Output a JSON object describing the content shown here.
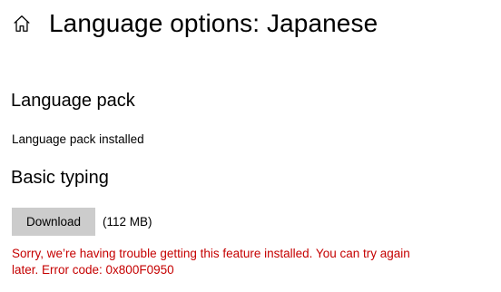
{
  "header": {
    "home_icon": "home-icon",
    "title": "Language options: Japanese"
  },
  "language_pack": {
    "heading": "Language pack",
    "status": "Language pack installed"
  },
  "basic_typing": {
    "heading": "Basic typing",
    "download_label": "Download",
    "size": "(112 MB)",
    "error": "Sorry, we’re having trouble getting this feature installed. You can try again later. Error code: 0x800F0950"
  },
  "colors": {
    "error": "#c50000",
    "button_bg": "#cccccc"
  }
}
